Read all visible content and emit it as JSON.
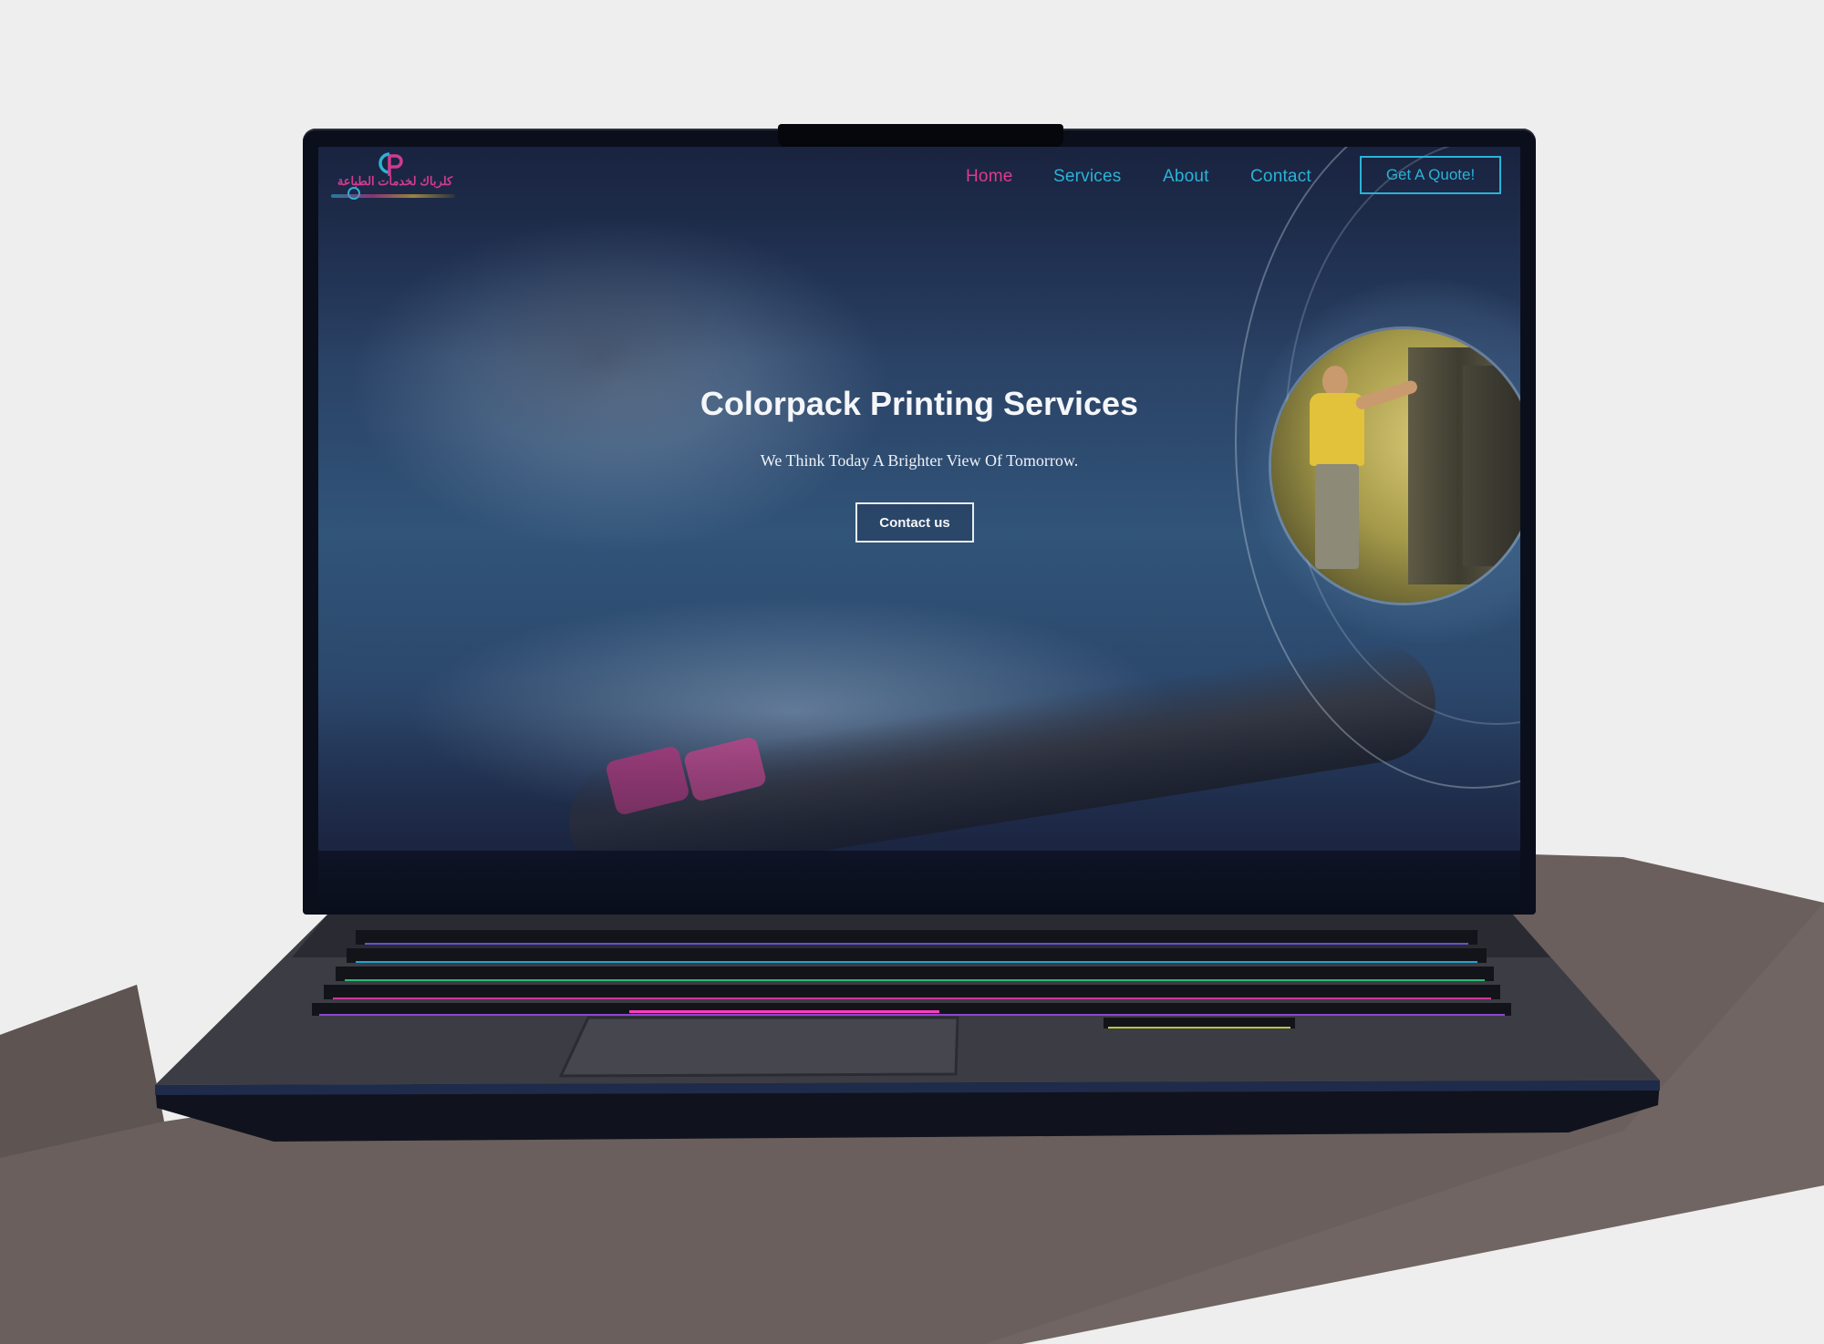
{
  "site": {
    "logo": {
      "arabic_text": "كلرباك لخدمات الطباعة",
      "mark_letters": "CP"
    },
    "nav": {
      "links": [
        {
          "label": "Home",
          "active": true
        },
        {
          "label": "Services",
          "active": false
        },
        {
          "label": "About",
          "active": false
        },
        {
          "label": "Contact",
          "active": false
        }
      ],
      "cta_label": "Get A Quote!"
    },
    "hero": {
      "title": "Colorpack Printing Services",
      "subtitle": "We Think Today A Brighter View Of Tomorrow.",
      "button_label": "Contact us"
    }
  },
  "colors": {
    "accent_cyan": "#2bb3d6",
    "accent_magenta": "#e03a8e",
    "hero_text": "#f4f6fa",
    "page_background": "#eeeeee",
    "laptop_body": "#0b0f1c"
  }
}
